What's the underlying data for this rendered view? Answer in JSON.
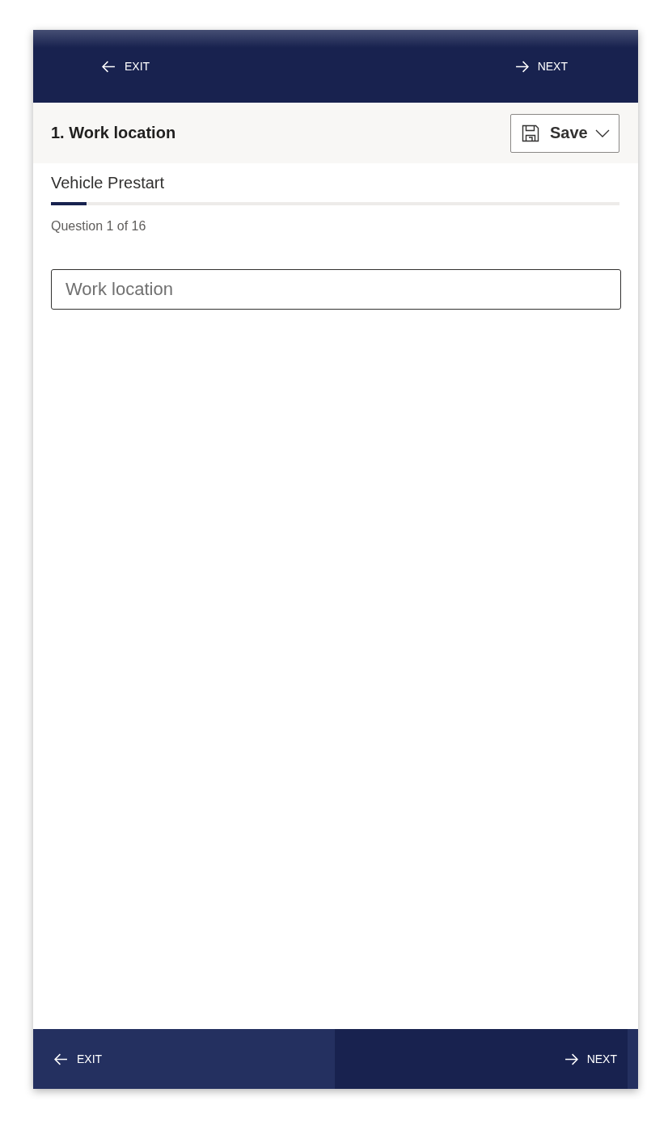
{
  "top_bar": {
    "buttons": [
      {
        "label": "EXIT",
        "kind": "back"
      },
      {
        "label": "NEXT",
        "kind": "forward"
      }
    ]
  },
  "header": {
    "title": "1. Work location",
    "save_button": {
      "label": "Save"
    }
  },
  "form": {
    "name": "Vehicle Prestart",
    "progress": {
      "level": 0.0625
    },
    "question_counter": "Question 1 of 16",
    "field": {
      "placeholder": "Work location"
    }
  },
  "bottom_bar": {
    "buttons": [
      {
        "label": "EXIT",
        "kind": "back"
      },
      {
        "label": "NEXT",
        "kind": "forward"
      }
    ]
  }
}
